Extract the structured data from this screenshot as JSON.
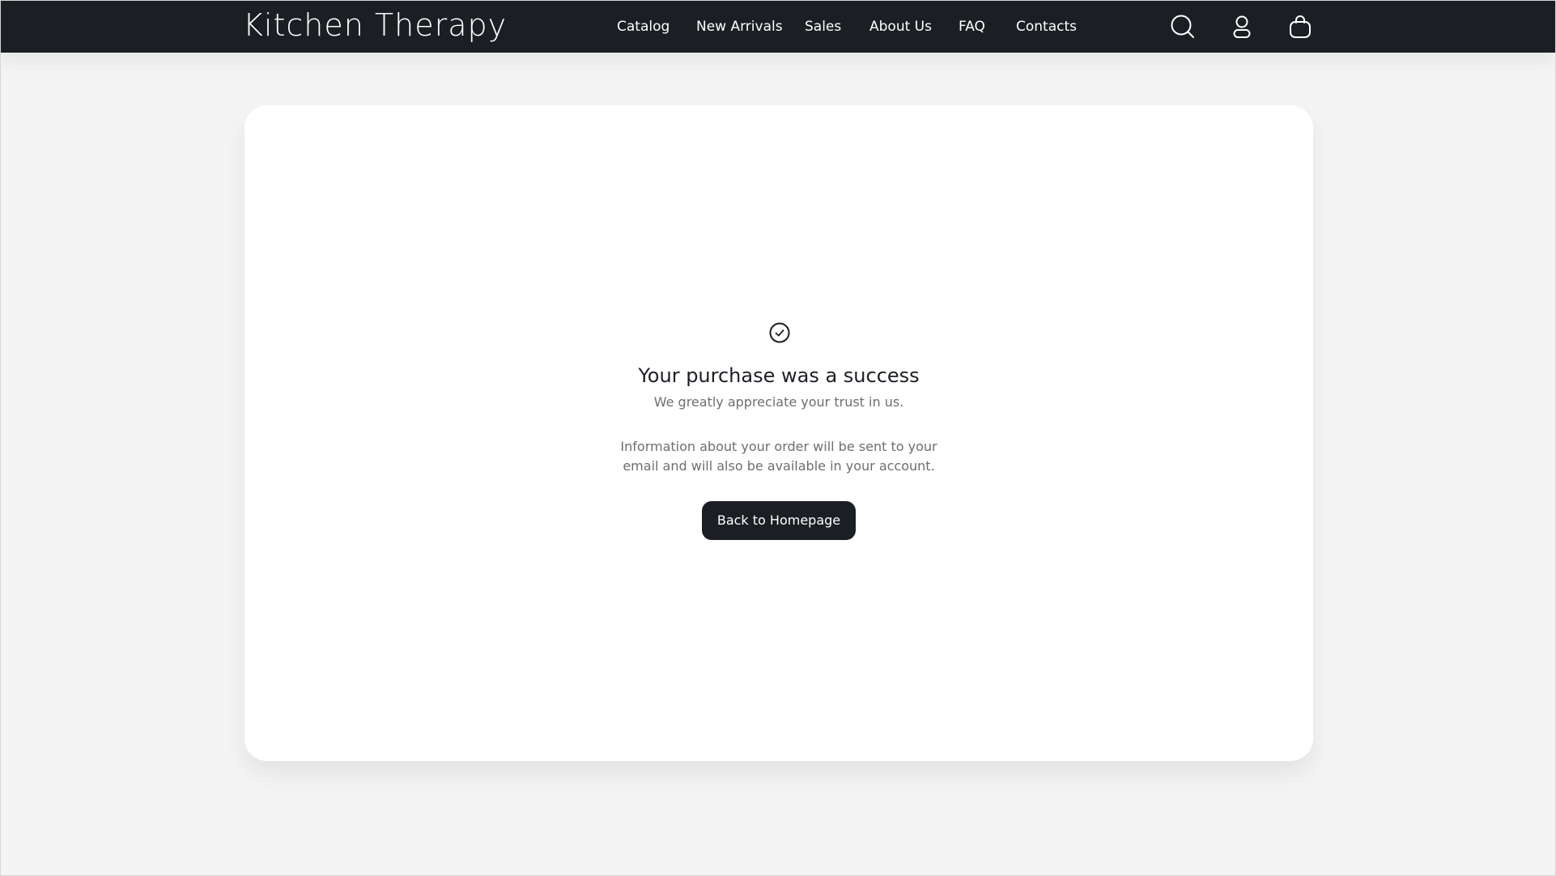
{
  "header": {
    "logo_text": "Kitchen Therapy",
    "nav": [
      {
        "label": "Catalog"
      },
      {
        "label": "New Arrivals"
      },
      {
        "label": "Sales"
      },
      {
        "label": "About Us"
      },
      {
        "label": "FAQ"
      },
      {
        "label": "Contacts"
      }
    ],
    "icons": [
      "search-icon",
      "user-icon",
      "shopping-bag-icon"
    ]
  },
  "confirmation": {
    "icon": "check-circle-icon",
    "title": "Your purchase was a success",
    "subtitle": "We greatly appreciate your trust in us.",
    "info": "Information about your order will be sent to your email and will also be available in your account.",
    "button_label": "Back to Homepage"
  },
  "colors": {
    "header_bg": "#1b1f24",
    "page_bg": "#f4f4f4",
    "card_bg": "#ffffff",
    "button_bg": "#1b1f24",
    "muted_text": "#6e6e6e"
  }
}
